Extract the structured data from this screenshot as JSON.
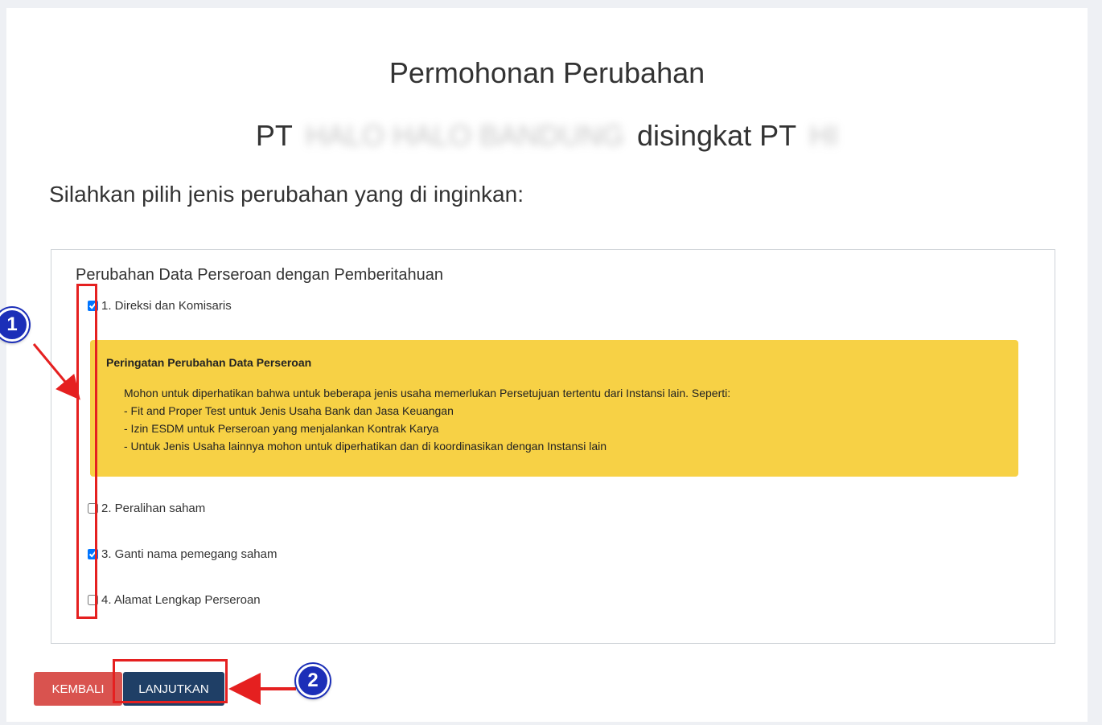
{
  "header": {
    "title": "Permohonan Perubahan",
    "company_prefix": "PT",
    "company_name_blurred": "HALO HALO BANDUNG",
    "abbrev_label": "disingkat PT",
    "abbrev_blurred": "HI"
  },
  "prompt": "Silahkan pilih jenis perubahan yang di inginkan:",
  "panel": {
    "heading": "Perubahan Data Perseroan dengan Pemberitahuan",
    "options": [
      {
        "label": "1. Direksi dan Komisaris",
        "checked": true
      },
      {
        "label": "2. Peralihan saham",
        "checked": false
      },
      {
        "label": "3. Ganti nama pemegang saham",
        "checked": true
      },
      {
        "label": "4. Alamat Lengkap Perseroan",
        "checked": false
      }
    ],
    "warning": {
      "title": "Peringatan Perubahan Data Perseroan",
      "lines": [
        "Mohon untuk diperhatikan bahwa untuk beberapa jenis usaha memerlukan Persetujuan tertentu dari Instansi lain. Seperti:",
        "- Fit and Proper Test untuk Jenis Usaha Bank dan Jasa Keuangan",
        "- Izin ESDM untuk Perseroan yang menjalankan Kontrak Karya",
        "- Untuk Jenis Usaha lainnya mohon untuk diperhatikan dan di koordinasikan dengan Instansi lain"
      ],
      "color": "#f7d145"
    }
  },
  "buttons": {
    "back_label": "KEMBALI",
    "next_label": "LANJUTKAN",
    "back_color": "#d9534f",
    "next_color": "#1f3f66"
  },
  "annotations": {
    "badge1": "1",
    "badge2": "2",
    "highlight_color": "#e52020",
    "badge_color": "#1c2fb8"
  }
}
